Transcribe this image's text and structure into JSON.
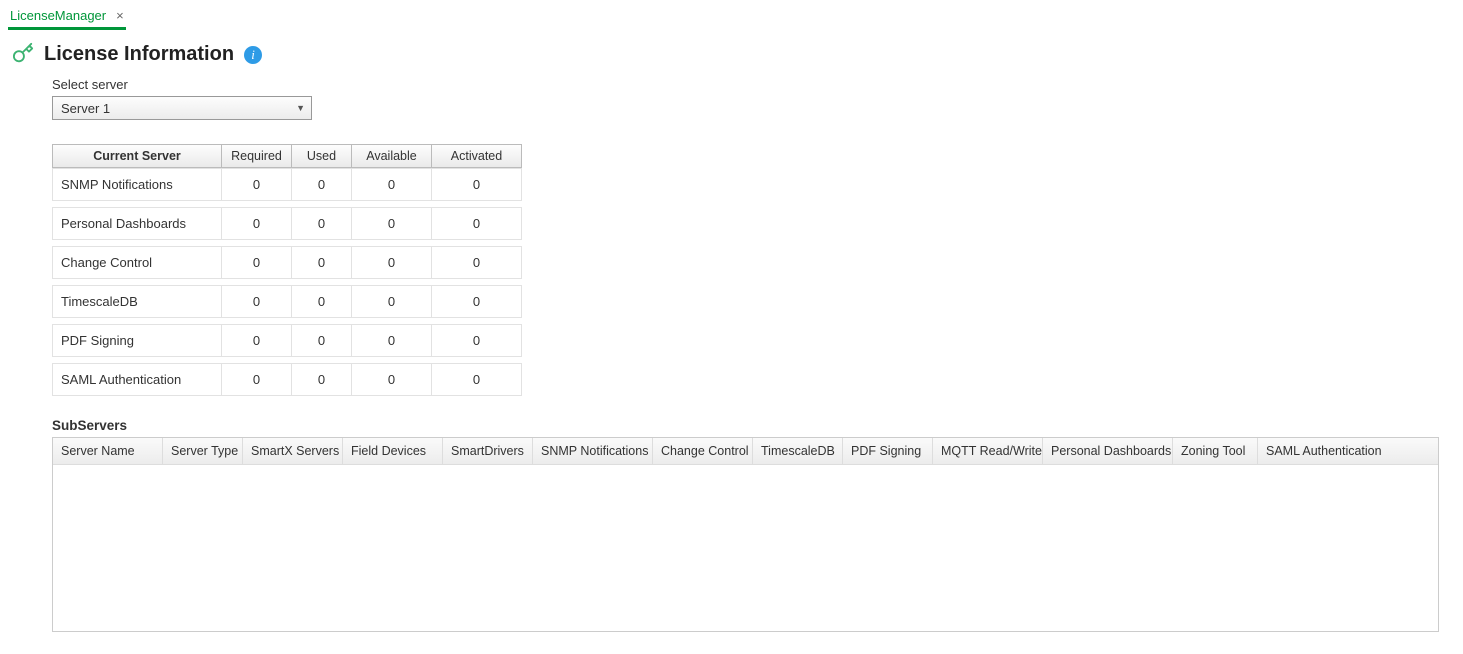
{
  "tab": {
    "label": "LicenseManager"
  },
  "header": {
    "title": "License Information"
  },
  "form": {
    "select_server_label": "Select server",
    "selected_server": "Server 1"
  },
  "licenseTable": {
    "headers": {
      "name": "Current Server",
      "required": "Required",
      "used": "Used",
      "available": "Available",
      "activated": "Activated"
    },
    "rows": [
      {
        "name": "SNMP Notifications",
        "required": "0",
        "used": "0",
        "available": "0",
        "activated": "0"
      },
      {
        "name": "Personal Dashboards",
        "required": "0",
        "used": "0",
        "available": "0",
        "activated": "0"
      },
      {
        "name": "Change Control",
        "required": "0",
        "used": "0",
        "available": "0",
        "activated": "0"
      },
      {
        "name": "TimescaleDB",
        "required": "0",
        "used": "0",
        "available": "0",
        "activated": "0"
      },
      {
        "name": "PDF Signing",
        "required": "0",
        "used": "0",
        "available": "0",
        "activated": "0"
      },
      {
        "name": "SAML Authentication",
        "required": "0",
        "used": "0",
        "available": "0",
        "activated": "0"
      }
    ]
  },
  "subservers": {
    "title": "SubServers",
    "columns": [
      "Server Name",
      "Server Type",
      "SmartX Servers",
      "Field Devices",
      "SmartDrivers",
      "SNMP Notifications",
      "Change Control",
      "TimescaleDB",
      "PDF Signing",
      "MQTT Read/Write",
      "Personal Dashboards",
      "Zoning Tool",
      "SAML Authentication"
    ]
  }
}
